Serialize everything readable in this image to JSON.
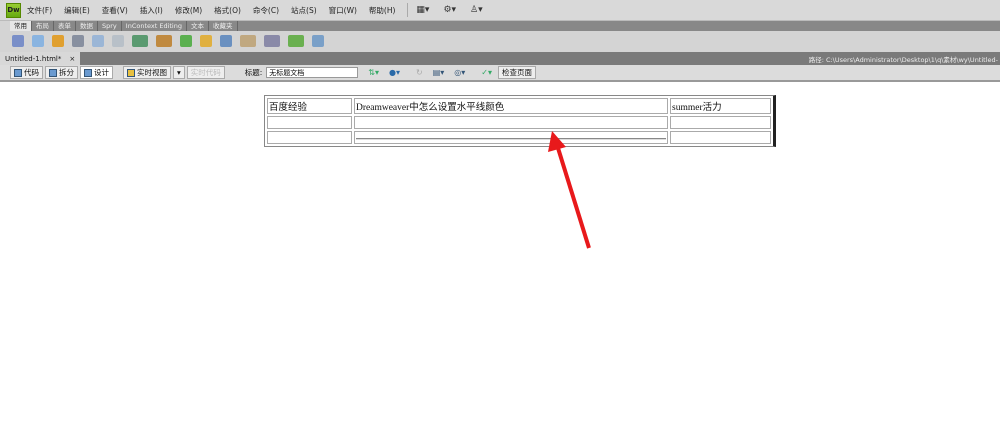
{
  "app": {
    "logo": "Dw"
  },
  "menu": [
    "文件(F)",
    "编辑(E)",
    "查看(V)",
    "插入(I)",
    "修改(M)",
    "格式(O)",
    "命令(C)",
    "站点(S)",
    "窗口(W)",
    "帮助(H)"
  ],
  "insert_tabs": [
    "常用",
    "布局",
    "表单",
    "数据",
    "Spry",
    "InContext Editing",
    "文本",
    "收藏夹"
  ],
  "document": {
    "tab": "Untitled-1.html*",
    "close": "×",
    "path": "路径:  C:\\Users\\Administrator\\Desktop\\1\\q\\素材\\wy\\Untitled-"
  },
  "toolbar": {
    "code": "代码",
    "split": "拆分",
    "design": "设计",
    "live_view": "实时视图",
    "live_code": "实时代码",
    "title_label": "标题:",
    "title_value": "无标题文档",
    "check_page": "检查页面"
  },
  "table": {
    "rows": [
      [
        "百度经验",
        "Dreamweaver中怎么设置水平线颜色",
        "summer活力"
      ],
      [
        "",
        "",
        ""
      ],
      [
        "",
        "",
        ""
      ]
    ]
  },
  "colors": {
    "arrow": "#e8191b"
  }
}
